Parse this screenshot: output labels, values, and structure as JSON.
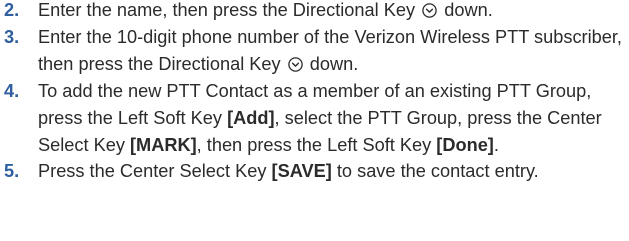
{
  "steps": [
    {
      "number": "2.",
      "parts": [
        {
          "t": "text",
          "v": "Enter the name, then press the Directional Key "
        },
        {
          "t": "icon",
          "name": "directional-key-down-icon"
        },
        {
          "t": "text",
          "v": " down."
        }
      ]
    },
    {
      "number": "3.",
      "parts": [
        {
          "t": "text",
          "v": "Enter the 10-digit phone number of the Verizon Wireless PTT subscriber, then press the Directional Key "
        },
        {
          "t": "icon",
          "name": "directional-key-down-icon"
        },
        {
          "t": "text",
          "v": " down."
        }
      ]
    },
    {
      "number": "4.",
      "parts": [
        {
          "t": "text",
          "v": "To add the new PTT Contact as a member of an existing PTT Group, press the Left Soft Key "
        },
        {
          "t": "bold",
          "v": "[Add]"
        },
        {
          "t": "text",
          "v": ", select the PTT Group, press the Center Select Key "
        },
        {
          "t": "bold",
          "v": "[MARK]"
        },
        {
          "t": "text",
          "v": ", then press the Left Soft Key "
        },
        {
          "t": "bold",
          "v": "[Done]"
        },
        {
          "t": "text",
          "v": "."
        }
      ]
    },
    {
      "number": "5.",
      "parts": [
        {
          "t": "text",
          "v": "Press the Center Select Key "
        },
        {
          "t": "bold",
          "v": "[SAVE]"
        },
        {
          "t": "text",
          "v": " to save the contact entry."
        }
      ]
    }
  ]
}
